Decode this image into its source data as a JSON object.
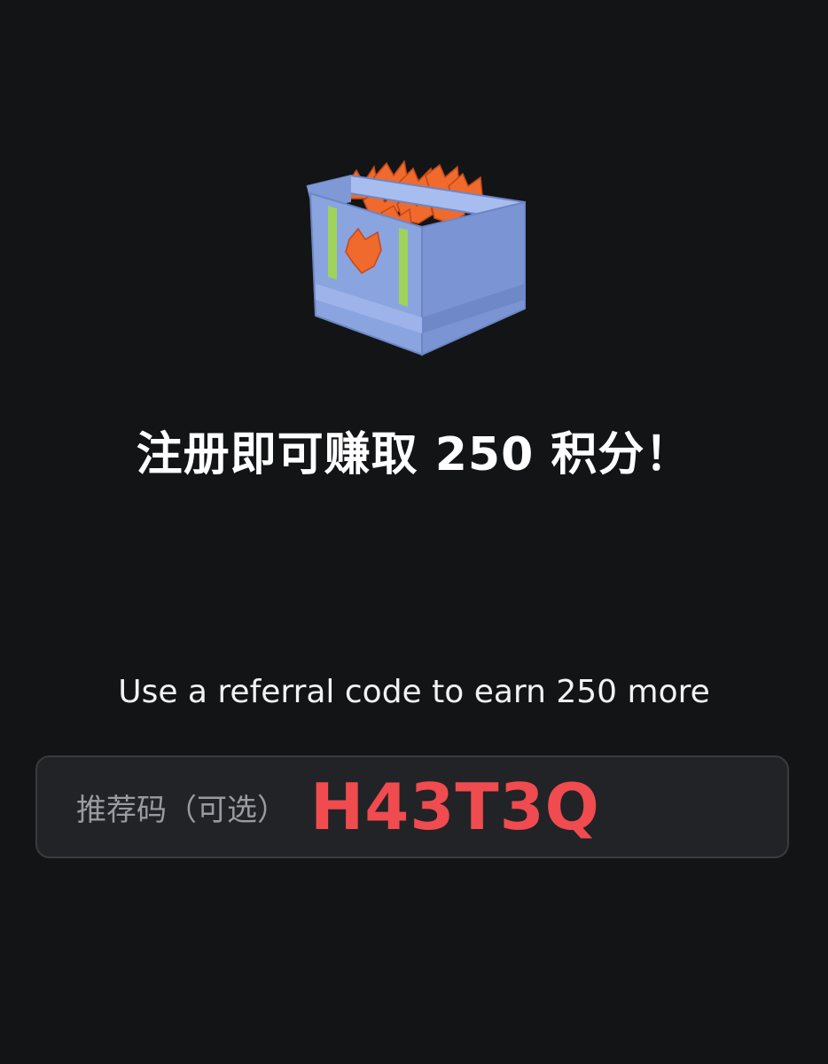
{
  "hero": {
    "icon": "fox-token-crate-icon"
  },
  "headline": "注册即可赚取 250 积分！",
  "subtext": "Use a referral code to earn 250 more",
  "referral": {
    "placeholder": "推荐码（可选）",
    "code": "H43T3Q"
  },
  "colors": {
    "background": "#131416",
    "field_background": "#222326",
    "field_border": "#3a3b3f",
    "code_text": "#f04b4f",
    "crate_blue": "#8aa4e0",
    "token_orange": "#ef6a2c",
    "accent_green": "#9fd35a"
  }
}
